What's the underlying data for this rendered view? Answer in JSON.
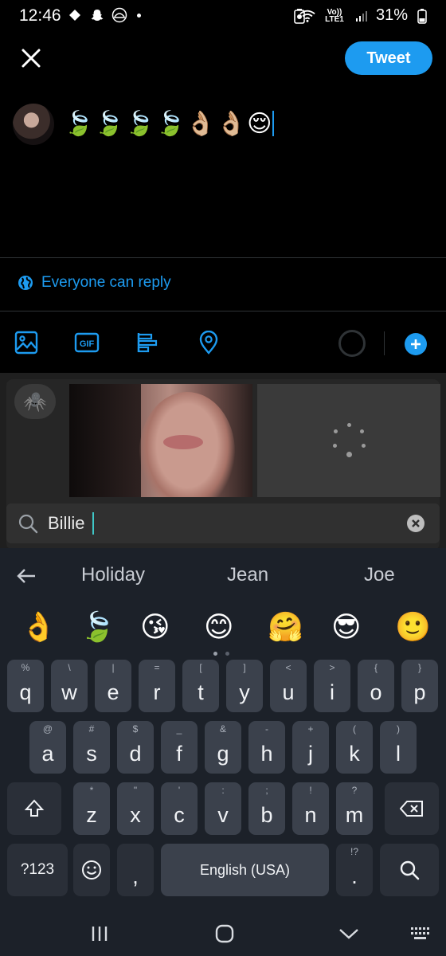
{
  "status_bar": {
    "time": "12:46",
    "battery": "31%",
    "network": "Vo)) LTE1",
    "icons": [
      "diamond-icon",
      "snapchat-icon",
      "sun-icon",
      "battery-saver-icon",
      "wifi-icon",
      "signal-icon",
      "battery-icon"
    ]
  },
  "composer": {
    "tweet_button": "Tweet",
    "text": "🍃🍃🍃🍃👌🏼👌🏼😌",
    "reply_setting": "Everyone can reply"
  },
  "toolbar": {
    "icons": [
      "image-icon",
      "gif-icon",
      "poll-icon",
      "location-icon"
    ],
    "gif_label": "GIF"
  },
  "gif_picker": {
    "search_value": "Billie",
    "recent_icon": "🕷️"
  },
  "keyboard": {
    "suggestions": [
      "Holiday",
      "Jean",
      "Joe"
    ],
    "emoji_suggestions": [
      "👌",
      "🍃",
      "😘",
      "😊",
      "🤗",
      "😎",
      "🙂"
    ],
    "row1": [
      {
        "main": "q",
        "alt": "%"
      },
      {
        "main": "w",
        "alt": "\\"
      },
      {
        "main": "e",
        "alt": "|"
      },
      {
        "main": "r",
        "alt": "="
      },
      {
        "main": "t",
        "alt": "["
      },
      {
        "main": "y",
        "alt": "]"
      },
      {
        "main": "u",
        "alt": "<"
      },
      {
        "main": "i",
        "alt": ">"
      },
      {
        "main": "o",
        "alt": "{"
      },
      {
        "main": "p",
        "alt": "}"
      }
    ],
    "row2": [
      {
        "main": "a",
        "alt": "@"
      },
      {
        "main": "s",
        "alt": "#"
      },
      {
        "main": "d",
        "alt": "$"
      },
      {
        "main": "f",
        "alt": "_"
      },
      {
        "main": "g",
        "alt": "&"
      },
      {
        "main": "h",
        "alt": "-"
      },
      {
        "main": "j",
        "alt": "+"
      },
      {
        "main": "k",
        "alt": "("
      },
      {
        "main": "l",
        "alt": ")"
      }
    ],
    "row3": [
      {
        "main": "z",
        "alt": "*"
      },
      {
        "main": "x",
        "alt": "\""
      },
      {
        "main": "c",
        "alt": "'"
      },
      {
        "main": "v",
        "alt": ":"
      },
      {
        "main": "b",
        "alt": ";"
      },
      {
        "main": "n",
        "alt": "!"
      },
      {
        "main": "m",
        "alt": "?"
      }
    ],
    "symbols_key": "?123",
    "comma_key": ",",
    "space_label": "English (USA)",
    "period_key": ".",
    "period_alt": "!?"
  }
}
